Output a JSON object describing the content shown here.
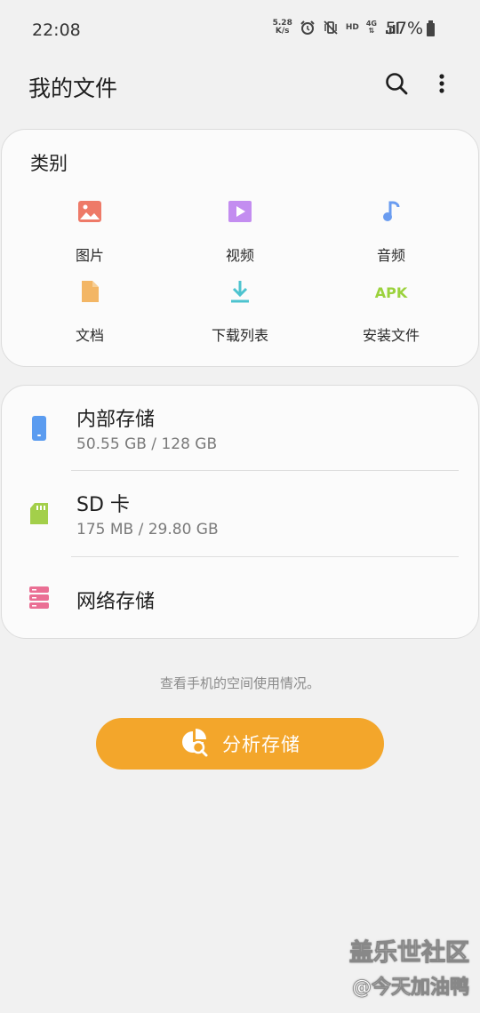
{
  "status_bar": {
    "time": "22:08",
    "net_speed_value": "5.28",
    "net_speed_unit": "K/s",
    "hd_label": "HD",
    "network_label": "4G",
    "battery": "57%"
  },
  "app_bar": {
    "title": "我的文件",
    "search_icon": "search-icon",
    "more_icon": "more-vertical-icon"
  },
  "categories": {
    "heading": "类别",
    "items": [
      {
        "label": "图片",
        "icon": "image-icon",
        "color": "#ee7a68"
      },
      {
        "label": "视频",
        "icon": "video-icon",
        "color": "#c38df0"
      },
      {
        "label": "音频",
        "icon": "music-icon",
        "color": "#6a9cf0"
      },
      {
        "label": "文档",
        "icon": "document-icon",
        "color": "#f3b665"
      },
      {
        "label": "下载列表",
        "icon": "download-icon",
        "color": "#4cc3cf"
      },
      {
        "label": "安装文件",
        "icon": "apk-icon",
        "icon_text": "APK",
        "color": "#9bd23c"
      }
    ]
  },
  "storage": {
    "items": [
      {
        "title": "内部存储",
        "subtitle": "50.55 GB / 128 GB",
        "icon": "phone-icon",
        "color": "#5b9cf0"
      },
      {
        "title": "SD 卡",
        "subtitle": "175 MB / 29.80 GB",
        "icon": "sd-card-icon",
        "color": "#a3cf4a"
      },
      {
        "title": "网络存储",
        "subtitle": "",
        "icon": "server-icon",
        "color": "#ea6f94"
      }
    ]
  },
  "analyze": {
    "hint": "查看手机的空间使用情况。",
    "button_label": "分析存储",
    "color": "#f3a62b"
  },
  "watermark": {
    "line1": "盖乐世社区",
    "line2": "@今天加油鸭"
  }
}
